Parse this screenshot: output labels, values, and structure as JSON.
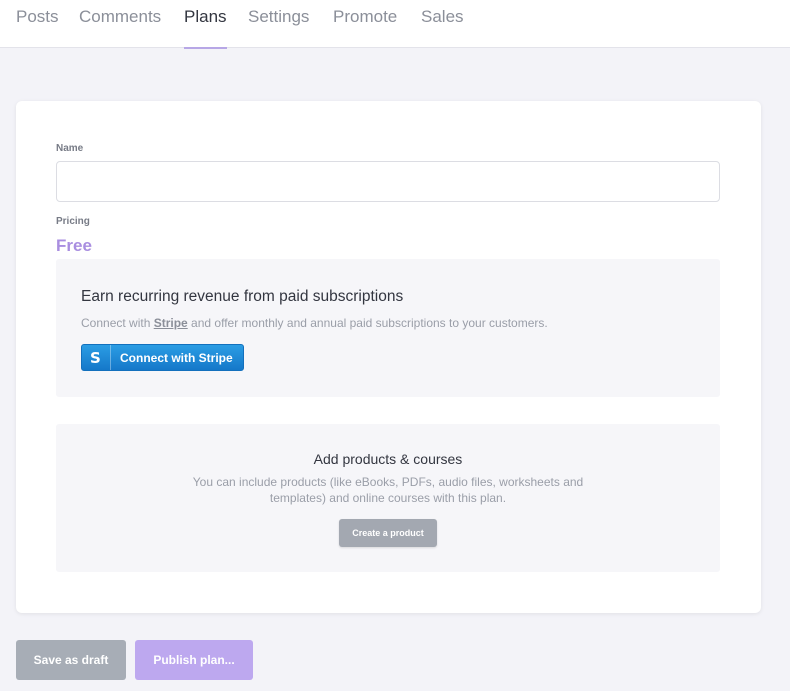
{
  "nav": {
    "tabs": [
      {
        "label": "Posts"
      },
      {
        "label": "Comments"
      },
      {
        "label": "Plans"
      },
      {
        "label": "Settings"
      },
      {
        "label": "Promote"
      },
      {
        "label": "Sales"
      }
    ],
    "active_tab": "Plans"
  },
  "form": {
    "name_label": "Name",
    "name_value": "",
    "pricing_label": "Pricing",
    "pricing_value": "Free"
  },
  "stripe_panel": {
    "title": "Earn recurring revenue from paid subscriptions",
    "desc_prefix": "Connect with ",
    "desc_link": "Stripe",
    "desc_suffix": " and offer monthly and annual paid subscriptions to your customers.",
    "button_icon_glyph": "S",
    "button_label": "Connect with Stripe"
  },
  "products_panel": {
    "title": "Add products & courses",
    "description": "You can include products (like eBooks, PDFs, audio files, worksheets and templates) and online courses with this plan.",
    "button_label": "Create a product"
  },
  "footer": {
    "draft_label": "Save as draft",
    "publish_label": "Publish plan..."
  },
  "colors": {
    "accent": "#a98ee0",
    "stripe_blue": "#1f8ad6",
    "button_grey": "#a7adb6",
    "publish_purple": "#bda8ef"
  }
}
